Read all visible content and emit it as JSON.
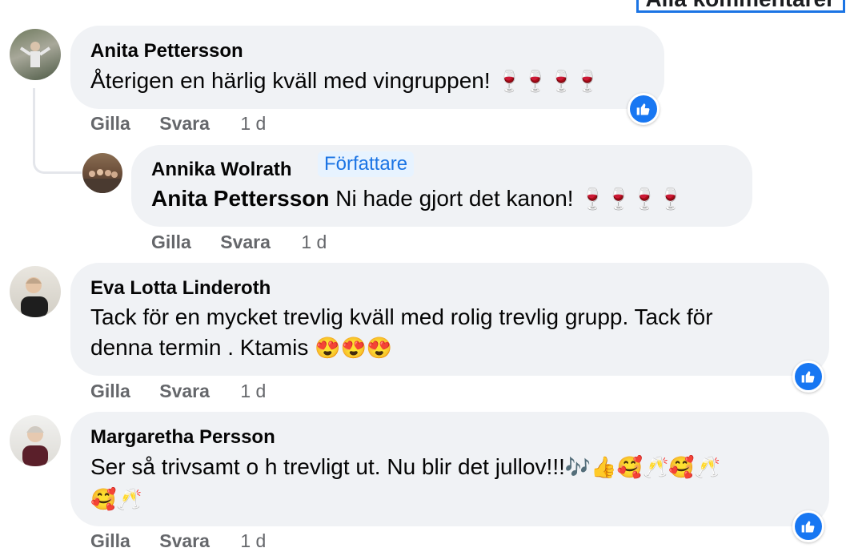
{
  "header": {
    "filter_label": "Alla kommentarer"
  },
  "icons": {
    "like": "thumbs-up-icon",
    "wine": "wine-glass-icon"
  },
  "colors": {
    "accent": "#1877f2",
    "bubble": "#f0f2f5",
    "meta": "#65676b"
  },
  "comments": [
    {
      "author": "Anita Pettersson",
      "text": "Återigen en härlig kväll med vingruppen!",
      "emojis": "🍷🍷🍷🍷",
      "actions": {
        "like": "Gilla",
        "reply": "Svara",
        "time": "1 d"
      },
      "reply": {
        "author": "Annika Wolrath",
        "badge": "Författare",
        "mention": "Anita Pettersson",
        "text": "Ni hade gjort det kanon!",
        "emojis": "🍷🍷🍷🍷",
        "actions": {
          "like": "Gilla",
          "reply": "Svara",
          "time": "1 d"
        }
      }
    },
    {
      "author": "Eva Lotta Linderoth",
      "text_line1": "Tack för en mycket trevlig kväll med rolig trevlig grupp. Tack för",
      "text_line2": "denna termin . Ktamis",
      "emojis": "😍😍😍",
      "actions": {
        "like": "Gilla",
        "reply": "Svara",
        "time": "1 d"
      }
    },
    {
      "author": "Margaretha Persson",
      "text_line1": "Ser så trivsamt o h trevligt ut. Nu blir det jullov!!!",
      "emojis_line1": "🎶👍🥰🥂🥰🥂",
      "emojis_line2": "🥰🥂",
      "actions": {
        "like": "Gilla",
        "reply": "Svara",
        "time": "1 d"
      }
    }
  ]
}
